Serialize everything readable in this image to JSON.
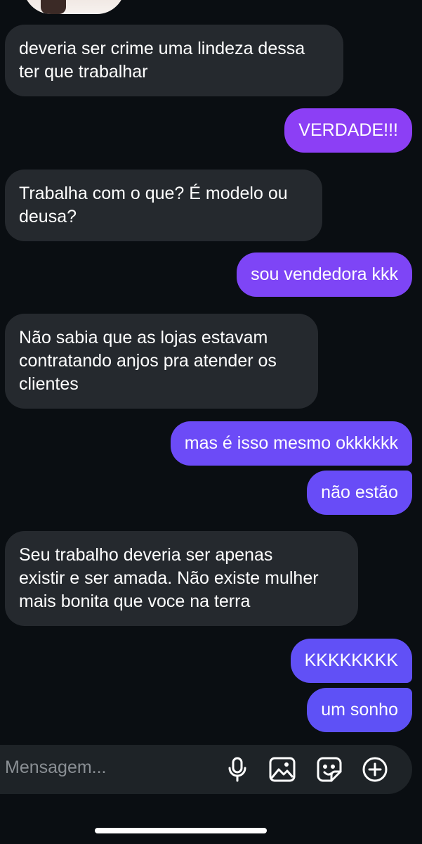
{
  "messages": {
    "m1": "deveria ser crime uma lindeza dessa\nter que trabalhar",
    "m2": "VERDADE!!!",
    "m3": "Trabalha com o que? É modelo ou\ndeusa?",
    "m4": "sou vendedora kkk",
    "m5": "Não sabia que as lojas estavam\ncontratando anjos pra atender os\nclientes",
    "m6": "mas é isso mesmo okkkkkk",
    "m7": "não estão",
    "m8": "Seu trabalho deveria ser apenas\nexistir e ser amada. Não existe mulher\nmais bonita que voce na terra",
    "m9": "KKKKKKKK",
    "m10": "um sonho"
  },
  "composer": {
    "placeholder": "Mensagem...",
    "icons": [
      "microphone-icon",
      "image-icon",
      "sticker-icon",
      "plus-circle-icon"
    ]
  },
  "colors": {
    "background": "#0a0e12",
    "incoming_bubble": "#25292e",
    "outgoing_violet": "#8c3ff5",
    "outgoing_purple": "#6c4bf7",
    "outgoing_blue": "#6150f6",
    "composer": "#1e2327"
  }
}
